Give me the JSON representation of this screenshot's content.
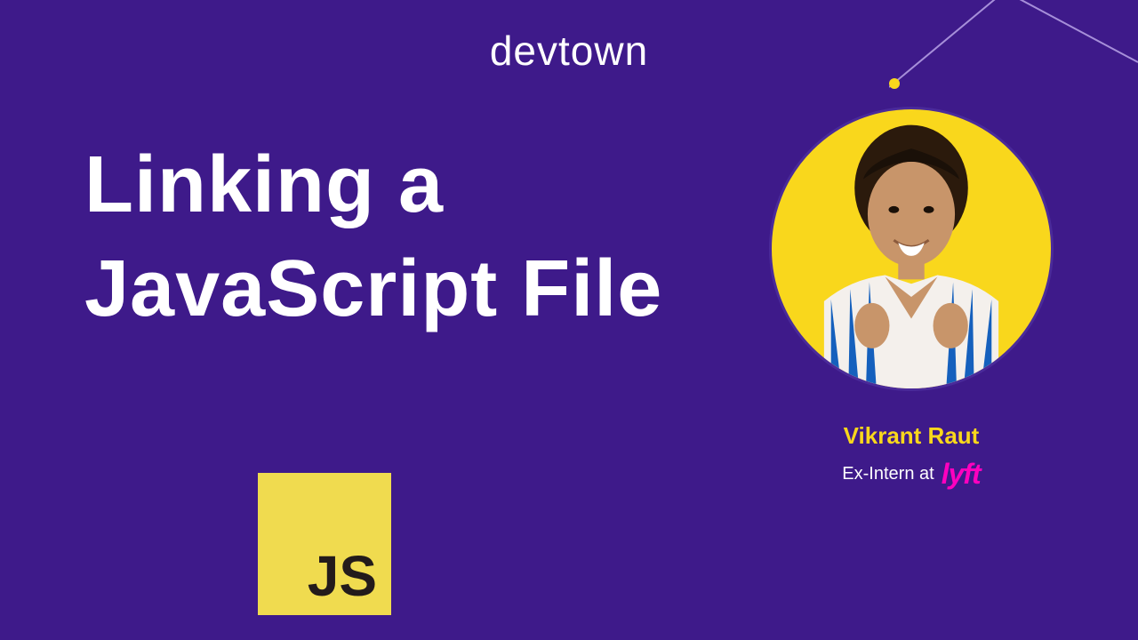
{
  "brand": "devtown",
  "title_line1": "Linking a",
  "title_line2": "JavaScript File",
  "js_badge": "JS",
  "presenter": {
    "name": "Vikrant Raut",
    "subtitle": "Ex-Intern at",
    "company": "lyft"
  }
}
